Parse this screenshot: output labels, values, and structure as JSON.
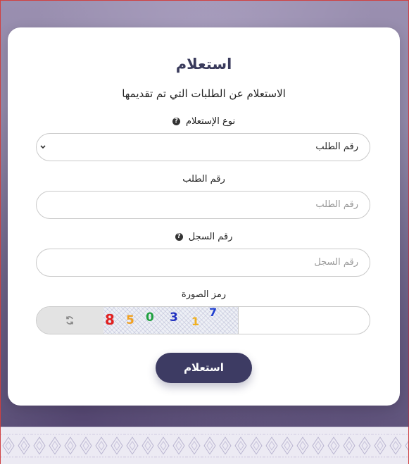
{
  "form": {
    "title": "استعلام",
    "subtitle": "الاستعلام عن الطلبات التي تم تقديمها",
    "inquiry_type": {
      "label": "نوع الإستعلام",
      "selected": "رقم الطلب"
    },
    "request_number": {
      "label": "رقم الطلب",
      "placeholder": "رقم الطلب"
    },
    "record_number": {
      "label": "رقم السجل",
      "placeholder": "رقم السجل"
    },
    "captcha": {
      "label": "رمز الصورة",
      "digits": [
        "8",
        "5",
        "0",
        "3",
        "1",
        "7"
      ],
      "digit_colors": [
        "#e02020",
        "#f0a020",
        "#20a040",
        "#2030c0",
        "#f0b020",
        "#2040d0"
      ]
    },
    "submit_label": "استعلام"
  },
  "colors": {
    "primary": "#3d3b63",
    "title": "#3a3b5c"
  }
}
